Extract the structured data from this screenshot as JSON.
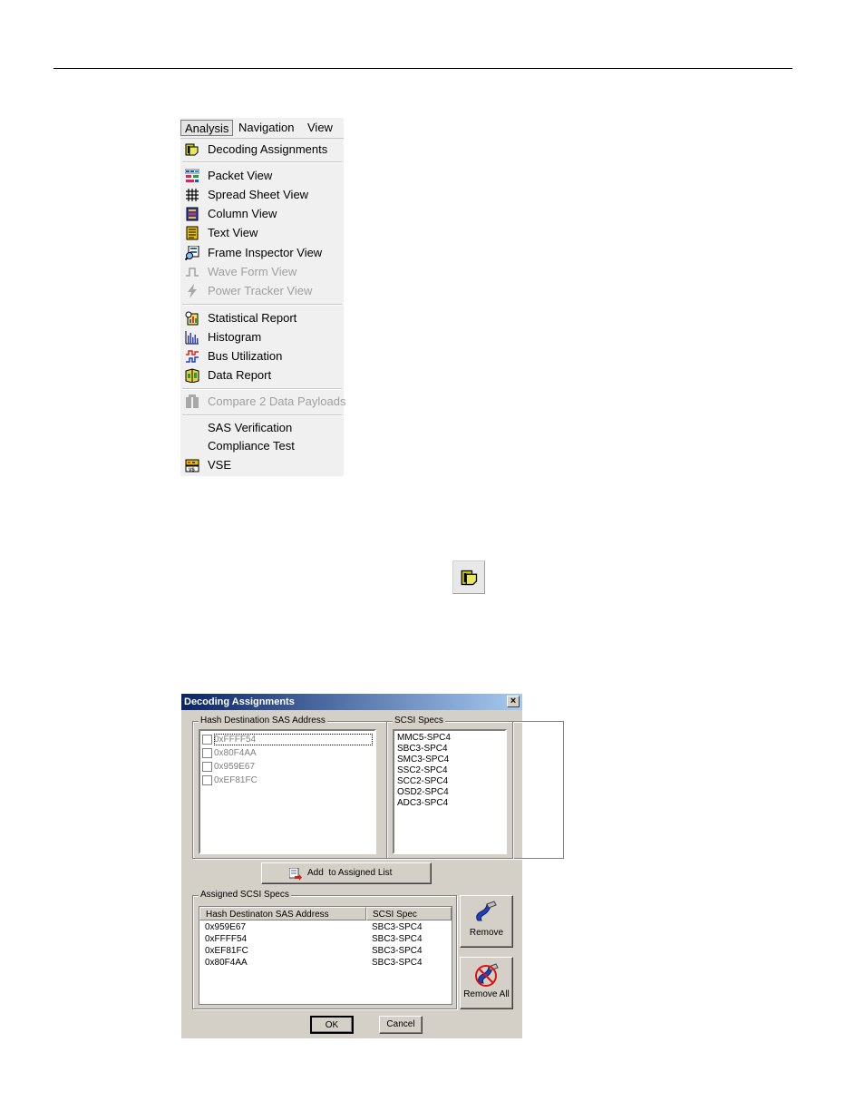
{
  "menu": {
    "top": [
      "Analysis",
      "Navigation",
      "View"
    ],
    "items": [
      {
        "label": "Decoding Assignments",
        "icon": "decoding-assignments-icon",
        "enabled": true
      },
      {
        "label": "Packet View",
        "icon": "packet-view-icon",
        "enabled": true
      },
      {
        "label": "Spread Sheet View",
        "icon": "spreadsheet-view-icon",
        "enabled": true
      },
      {
        "label": "Column View",
        "icon": "column-view-icon",
        "enabled": true
      },
      {
        "label": "Text View",
        "icon": "text-view-icon",
        "enabled": true
      },
      {
        "label": "Frame Inspector View",
        "icon": "frame-inspector-icon",
        "enabled": true
      },
      {
        "label": "Wave Form View",
        "icon": "waveform-icon",
        "enabled": false
      },
      {
        "label": "Power Tracker View",
        "icon": "power-tracker-icon",
        "enabled": false
      },
      {
        "label": "Statistical Report",
        "icon": "statistical-report-icon",
        "enabled": true
      },
      {
        "label": "Histogram",
        "icon": "histogram-icon",
        "enabled": true
      },
      {
        "label": "Bus Utilization",
        "icon": "bus-utilization-icon",
        "enabled": true
      },
      {
        "label": "Data Report",
        "icon": "data-report-icon",
        "enabled": true
      },
      {
        "label": "Compare 2 Data Payloads",
        "icon": "compare-payloads-icon",
        "enabled": false
      },
      {
        "label": "SAS Verification",
        "icon": "",
        "enabled": true
      },
      {
        "label": "Compliance Test",
        "icon": "",
        "enabled": true
      },
      {
        "label": "VSE",
        "icon": "vse-icon",
        "enabled": true
      }
    ]
  },
  "toolbar_icon": "decoding-assignments-icon",
  "dialog": {
    "title": "Decoding Assignments",
    "close": "×",
    "hash_group_label": "Hash Destination SAS Address",
    "hash_addresses": [
      "0xFFFF54",
      "0x80F4AA",
      "0x959E67",
      "0xEF81FC"
    ],
    "scsi_group_label": "SCSI Specs",
    "scsi_specs": [
      "MMC5-SPC4",
      "SBC3-SPC4",
      "SMC3-SPC4",
      "SSC2-SPC4",
      "SCC2-SPC4",
      "OSD2-SPC4",
      "ADC3-SPC4"
    ],
    "add_button": "Add  to Assigned List",
    "assigned_group_label": "Assigned SCSI Specs",
    "columns": [
      "Hash Destinaton SAS Address",
      "SCSI Spec"
    ],
    "rows": [
      [
        "0x959E67",
        "SBC3-SPC4"
      ],
      [
        "0xFFFF54",
        "SBC3-SPC4"
      ],
      [
        "0xEF81FC",
        "SBC3-SPC4"
      ],
      [
        "0x80F4AA",
        "SBC3-SPC4"
      ]
    ],
    "remove_button": "Remove",
    "remove_all_button": "Remove All",
    "ok_button": "OK",
    "cancel_button": "Cancel"
  }
}
